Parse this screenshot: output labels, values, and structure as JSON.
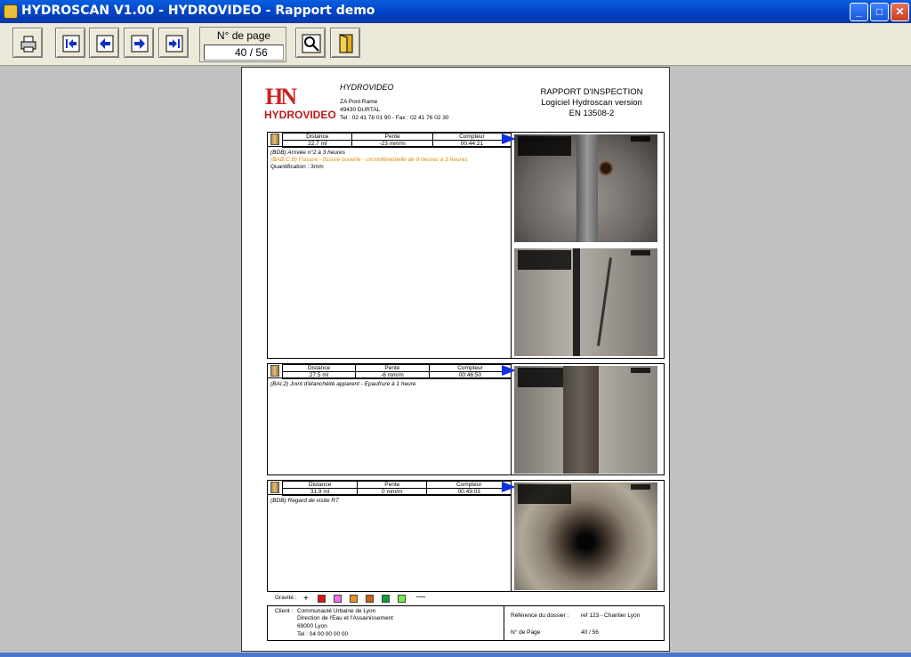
{
  "window": {
    "title": "HYDROSCAN V1.00 - HYDROVIDEO - Rapport demo",
    "min": "_",
    "max": "□",
    "close": "✕"
  },
  "toolbar": {
    "page_label": "N° de page",
    "page_current": "40",
    "page_sep": "/",
    "page_total": "56"
  },
  "report": {
    "logo_text": "HYDROVIDEO",
    "company": "HYDROVIDEO",
    "addr1": "ZA Pont Rame",
    "addr2": "49430 DURTAL",
    "phone": "Tel : 02 41 76 01 90 - Fax : 02 41 76 02 30",
    "title1": "RAPPORT D'INSPECTION",
    "title2": "Logiciel Hydroscan version",
    "title3": "EN 13508-2"
  },
  "headers": {
    "distance": "Distance",
    "pente": "Pente",
    "compteur": "Compteur"
  },
  "blocks": [
    {
      "distance": "22.7 ml",
      "pente": "-23 mm/m",
      "compteur": "00:44:21",
      "obs1": "(BDB) Arrivée n°2 à 3 heures",
      "obs2": "(BAB.C.B) Fissure - fissure ouverte - circonférentielle de 9 heures à 3 heures",
      "obs3": "Quantification : 3mm"
    },
    {
      "distance": "27.5 ml",
      "pente": "-6 mm/m",
      "compteur": "00:46:50",
      "obs1": "(BAI.2) Joint d'étanchéité apparent - Epaufrure à 1 heure"
    },
    {
      "distance": "31.9 ml",
      "pente": "0 mm/m",
      "compteur": "00:49:03",
      "obs1": "(BDB) Regard de visite R7"
    }
  ],
  "grade_label": "Gravité :",
  "grade_colors": [
    "#e01010",
    "#f070f0",
    "#f09020",
    "#d06010",
    "#10a030",
    "#70f040"
  ],
  "footer": {
    "client_label": "Client :",
    "client1": "Communauté Urbaine de Lyon",
    "client2": "Direction de l'Eau et l'Assainissement",
    "client3": "69000 Lyon",
    "client4": "Tel : 04 00 00 00 00",
    "ref_label": "Référence du dossier :",
    "ref_value": "ref 123 - Chantier Lyon",
    "page_label": "N° de Page",
    "page_value": "40 / 56"
  }
}
